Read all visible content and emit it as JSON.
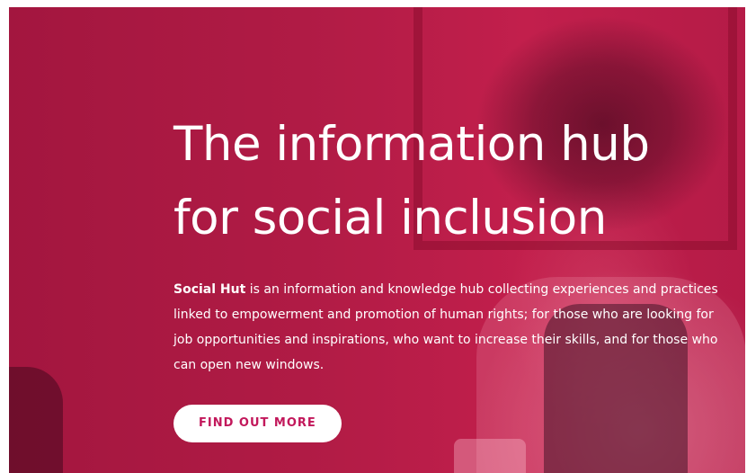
{
  "hero": {
    "title_line1": "The information hub",
    "title_line2": "for social inclusion",
    "description_brand": "Social Hut",
    "description_text": " is an information and knowledge hub collecting experiences and practices linked to empowerment and promotion of human rights; for those who are looking for job opportunities and inspirations, who want to increase their skills, and for those who can open new windows.",
    "cta_label": "FIND OUT MORE"
  },
  "colors": {
    "hero_overlay": "#b01b45",
    "cta_text": "#c2185b",
    "cta_background": "#ffffff",
    "text": "#ffffff"
  }
}
